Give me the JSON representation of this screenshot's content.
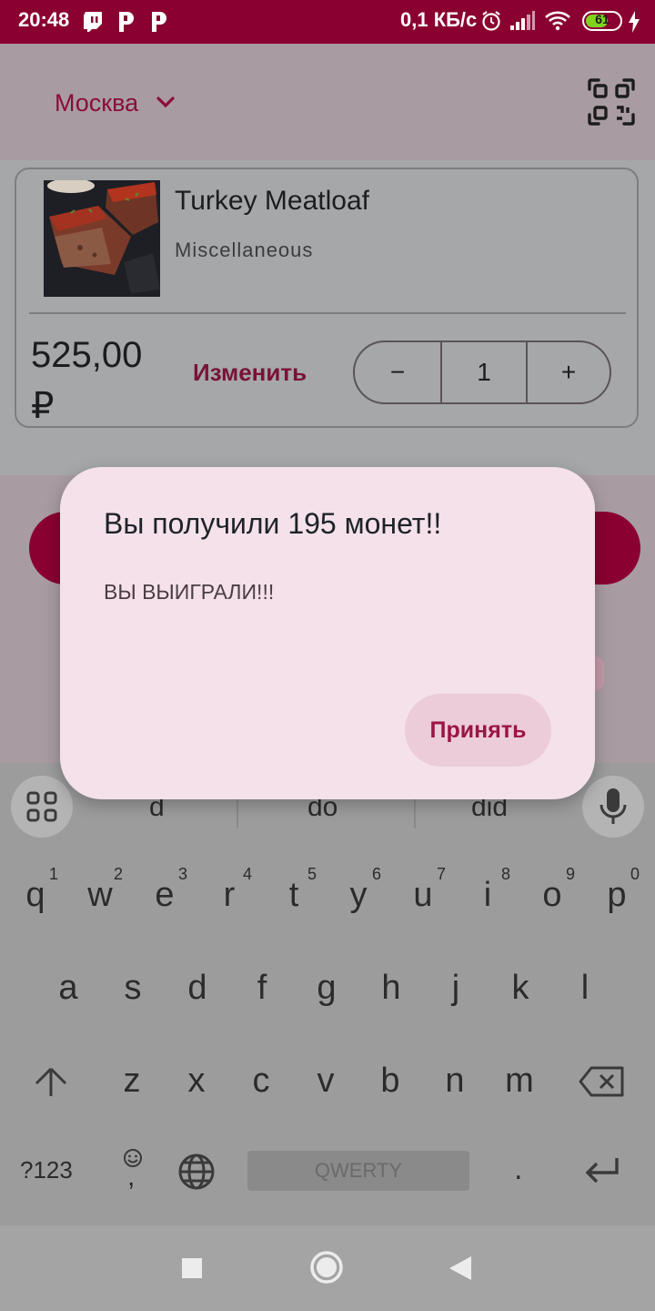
{
  "status": {
    "time": "20:48",
    "speed": "0,1 КБ/с",
    "battery": "61",
    "icons": [
      "twitch-icon",
      "p-icon",
      "p-icon",
      "alarm-icon",
      "signal-icon",
      "wifi-icon",
      "battery-icon",
      "charging-icon"
    ]
  },
  "header": {
    "city": "Москва",
    "qr_icon": "qr-code-icon"
  },
  "product": {
    "name": "Turkey Meatloaf",
    "category": "Miscellaneous",
    "price": "525,00 ₽",
    "edit_label": "Изменить",
    "minus": "−",
    "quantity": "1",
    "plus": "+"
  },
  "dialog": {
    "title": "Вы получили 195 монет!!",
    "message": "ВЫ ВЫИГРАЛИ!!!",
    "accept_label": "Принять"
  },
  "keyboard": {
    "suggestions": [
      "d",
      "do",
      "did"
    ],
    "row1": [
      "q",
      "w",
      "e",
      "r",
      "t",
      "y",
      "u",
      "i",
      "o",
      "p"
    ],
    "row1_hints": [
      "1",
      "2",
      "3",
      "4",
      "5",
      "6",
      "7",
      "8",
      "9",
      "0"
    ],
    "row2": [
      "a",
      "s",
      "d",
      "f",
      "g",
      "h",
      "j",
      "k",
      "l"
    ],
    "row3": [
      "z",
      "x",
      "c",
      "v",
      "b",
      "n",
      "m"
    ],
    "symbols_label": "?123",
    "comma": ",",
    "space_label": "QWERTY",
    "period": "."
  },
  "colors": {
    "brand": "#8a0030",
    "dialog_bg": "#f4e1ea",
    "accent_text": "#9b1546"
  }
}
